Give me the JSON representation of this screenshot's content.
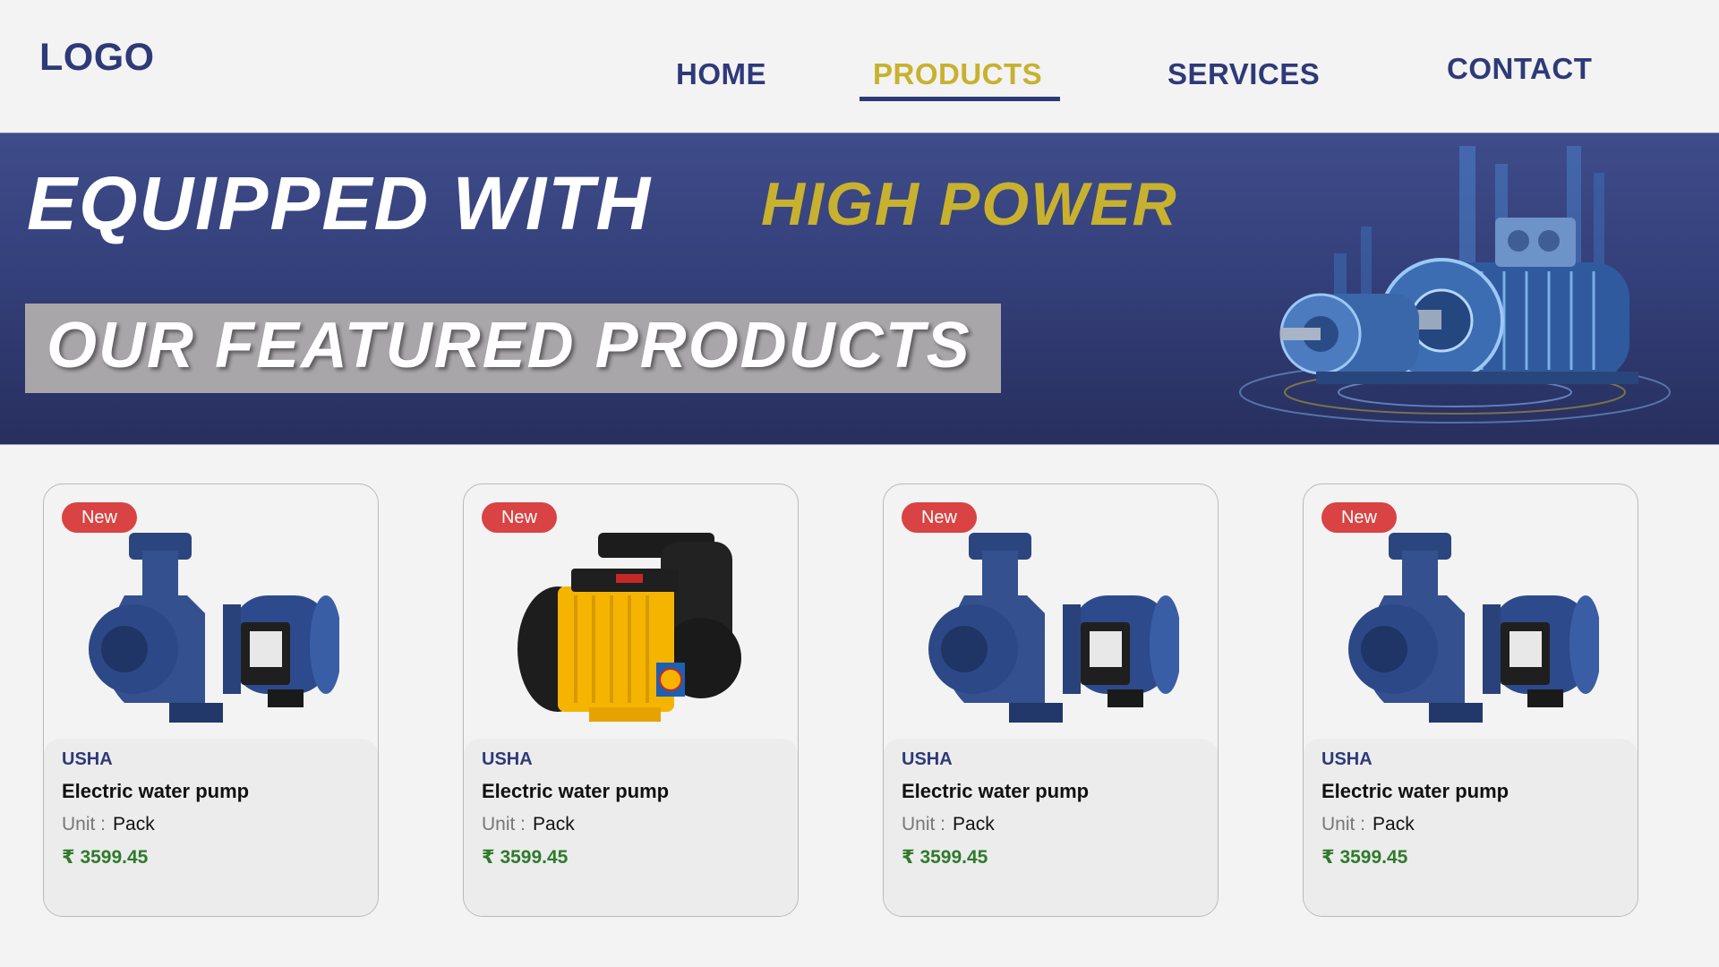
{
  "header": {
    "logo": "LOGO",
    "nav": [
      {
        "label": "HOME",
        "active": false
      },
      {
        "label": "PRODUCTS",
        "active": true
      },
      {
        "label": "SERVICES",
        "active": false
      },
      {
        "label": "CONTACT",
        "active": false
      }
    ]
  },
  "banner": {
    "headline": "EQUIPPED WITH",
    "headline_accent": "HIGH POWER",
    "subheadline": "OUR FEATURED PRODUCTS"
  },
  "products": [
    {
      "badge": "New",
      "brand": "USHA",
      "name": "Electric water pump",
      "unit_label": "Unit :",
      "unit_value": "Pack",
      "price": "₹ 3599.45",
      "image": "blue-centrifugal-pump"
    },
    {
      "badge": "New",
      "brand": "USHA",
      "name": "Electric water pump",
      "unit_label": "Unit :",
      "unit_value": "Pack",
      "price": "₹ 3599.45",
      "image": "yellow-self-priming-pump"
    },
    {
      "badge": "New",
      "brand": "USHA",
      "name": "Electric water pump",
      "unit_label": "Unit :",
      "unit_value": "Pack",
      "price": "₹ 3599.45",
      "image": "blue-centrifugal-pump"
    },
    {
      "badge": "New",
      "brand": "USHA",
      "name": "Electric water pump",
      "unit_label": "Unit :",
      "unit_value": "Pack",
      "price": "₹ 3599.45",
      "image": "blue-centrifugal-pump"
    }
  ],
  "colors": {
    "brand_navy": "#2e3a78",
    "accent_gold": "#c8b12f",
    "badge_red": "#d94343",
    "price_green": "#2f7a2b"
  }
}
